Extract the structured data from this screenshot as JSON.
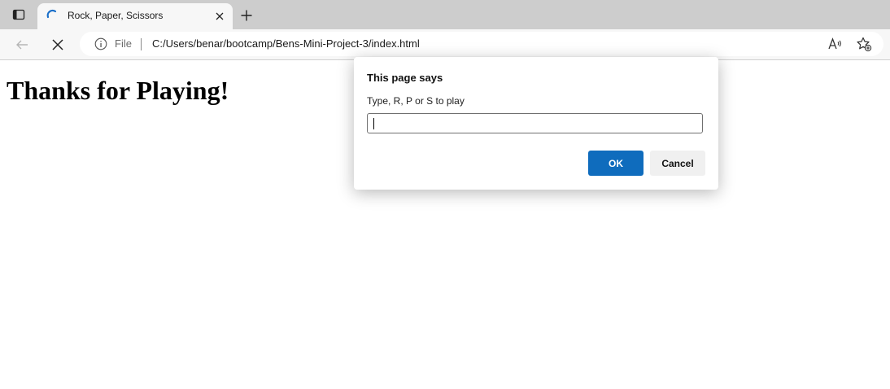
{
  "browser": {
    "tab": {
      "title": "Rock, Paper, Scissors",
      "favicon": "loading-spinner-icon"
    },
    "address": {
      "scheme_label": "File",
      "url": "C:/Users/benar/bootcamp/Bens-Mini-Project-3/index.html"
    },
    "icons": {
      "tab_actions": "tab-actions-icon",
      "close_tab": "close-icon",
      "new_tab": "plus-icon",
      "back": "back-arrow-icon",
      "stop": "stop-icon",
      "info": "info-icon",
      "read_aloud": "read-aloud-icon",
      "favorites": "add-favorite-icon"
    }
  },
  "page": {
    "heading": "Thanks for Playing!"
  },
  "dialog": {
    "title": "This page says",
    "message": "Type, R, P or S to play",
    "input_value": "",
    "ok_label": "OK",
    "cancel_label": "Cancel"
  },
  "colors": {
    "accent": "#0f6cbd",
    "tabbar": "#cdcdcd",
    "toolbar": "#f7f7f7"
  }
}
